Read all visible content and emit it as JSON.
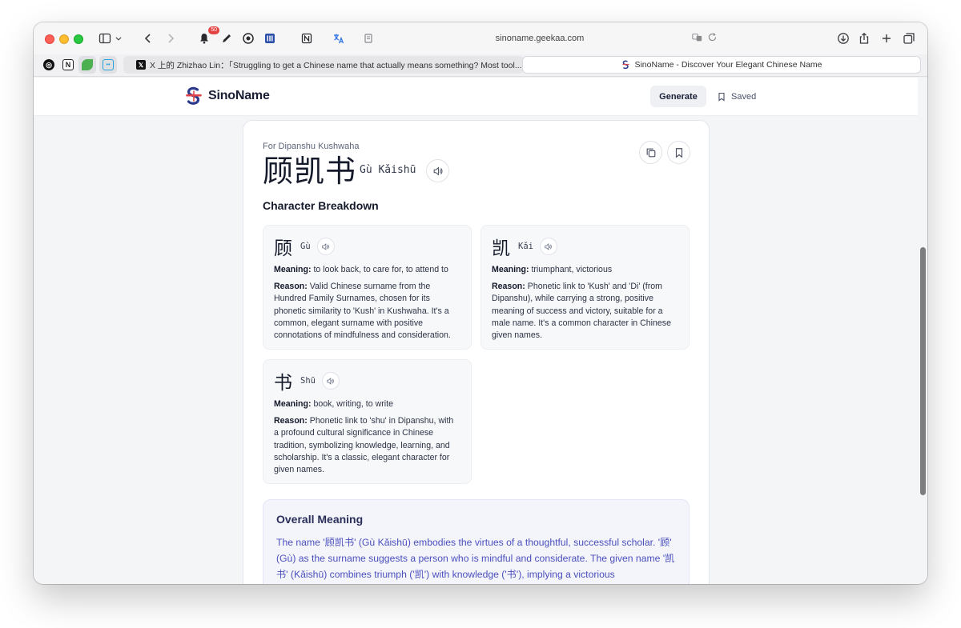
{
  "browser": {
    "url": "sinoname.geekaa.com",
    "notification_count": "50",
    "tabs": [
      {
        "label": "X 上的 Zhizhao Lin：「Struggling to get a Chinese name that actually means something? Most tool..."
      },
      {
        "label": "SinoName - Discover Your Elegant Chinese Name"
      }
    ]
  },
  "site": {
    "logo_text": "SinoName",
    "nav": {
      "generate": "Generate",
      "saved": "Saved"
    }
  },
  "result": {
    "for_line": "For Dipanshu Kushwaha",
    "name_han": "顾凯书",
    "name_pinyin": "Gù Kǎishū",
    "breakdown_title": "Character Breakdown",
    "meaning_label": "Meaning:",
    "reason_label": "Reason:",
    "characters": [
      {
        "han": "顾",
        "pinyin": "Gù",
        "meaning": "to look back, to care for, to attend to",
        "reason": "Valid Chinese surname from the Hundred Family Surnames, chosen for its phonetic similarity to 'Kush' in Kushwaha. It's a common, elegant surname with positive connotations of mindfulness and consideration."
      },
      {
        "han": "凯",
        "pinyin": "Kǎi",
        "meaning": "triumphant, victorious",
        "reason": "Phonetic link to 'Kush' and 'Di' (from Dipanshu), while carrying a strong, positive meaning of success and victory, suitable for a male name. It's a common character in Chinese given names."
      },
      {
        "han": "书",
        "pinyin": "Shū",
        "meaning": "book, writing, to write",
        "reason": "Phonetic link to 'shu' in Dipanshu, with a profound cultural significance in Chinese tradition, symbolizing knowledge, learning, and scholarship. It's a classic, elegant character for given names."
      }
    ],
    "overall_title": "Overall Meaning",
    "overall_text": "The name '顾凯书' (Gù Kǎishū) embodies the virtues of a thoughtful, successful scholar. '顾' (Gù) as the surname suggests a person who is mindful and considerate. The given name '凯书' (Kǎishū) combines triumph ('凯') with knowledge ('书'), implying a victorious"
  },
  "colors": {
    "accent_text": "#4a4fbd",
    "heading": "#151a2b"
  }
}
